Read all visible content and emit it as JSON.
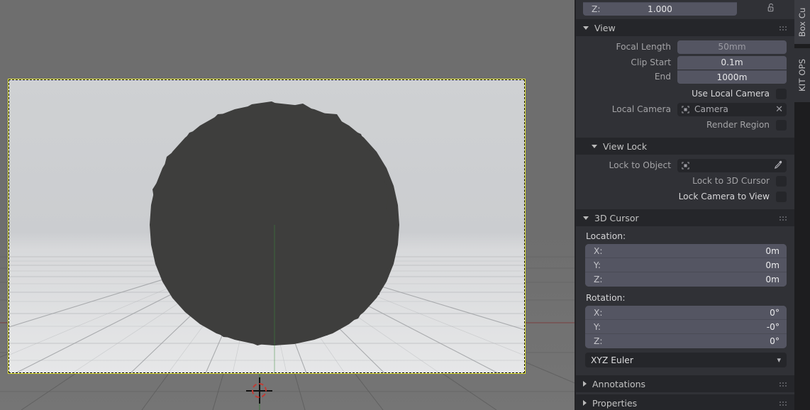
{
  "app": "blender-3d-viewport",
  "viewport": {
    "name": "3d-viewport",
    "camera_frame_visible": true,
    "cursor_icon": "3d-cursor-icon",
    "object": "low-poly-sphere"
  },
  "sidebar": {
    "top_field": {
      "label": "Z:",
      "value": "1.000",
      "lock_icon": "unlocked-padlock-icon"
    },
    "panels": [
      {
        "name": "view",
        "title": "View",
        "expanded": true,
        "grip_icon": "drag-handle-icon",
        "rows": [
          {
            "label": "Focal Length",
            "value": "50mm",
            "dim": true
          },
          {
            "label": "Clip Start",
            "value": "0.1m",
            "dim": false
          },
          {
            "label": "End",
            "value": "1000m",
            "dim": false
          }
        ],
        "checkboxes": [
          {
            "label": "Use Local Camera",
            "checked": false,
            "dim": false
          },
          {
            "label": "Render Region",
            "checked": false,
            "dim": true
          }
        ],
        "local_camera": {
          "label": "Local Camera",
          "value": "Camera",
          "object_icon": "camera-object-icon",
          "clear_icon": "close-x-icon"
        }
      },
      {
        "name": "view-lock",
        "title": "View Lock",
        "expanded": true,
        "lock_to_object": {
          "label": "Lock to Object",
          "value": "",
          "object_icon": "object-data-icon",
          "eyedropper_icon": "eyedropper-icon"
        },
        "checkboxes": [
          {
            "label": "Lock to 3D Cursor",
            "checked": false,
            "dim": true
          },
          {
            "label": "Lock Camera to View",
            "checked": false,
            "dim": false
          }
        ]
      },
      {
        "name": "3d-cursor",
        "title": "3D Cursor",
        "expanded": true,
        "grip_icon": "drag-handle-icon",
        "location": {
          "heading": "Location:",
          "axes": [
            {
              "axis": "X:",
              "value": "0m"
            },
            {
              "axis": "Y:",
              "value": "0m"
            },
            {
              "axis": "Z:",
              "value": "0m"
            }
          ]
        },
        "rotation": {
          "heading": "Rotation:",
          "axes": [
            {
              "axis": "X:",
              "value": "0°"
            },
            {
              "axis": "Y:",
              "value": "-0°"
            },
            {
              "axis": "Z:",
              "value": "0°"
            }
          ]
        },
        "rotation_mode": {
          "value": "XYZ Euler",
          "chevron_icon": "chevron-down-icon"
        }
      },
      {
        "name": "annotations",
        "title": "Annotations",
        "expanded": false,
        "grip_icon": "drag-handle-icon"
      },
      {
        "name": "properties",
        "title": "Properties",
        "expanded": false,
        "grip_icon": "drag-handle-icon"
      }
    ]
  },
  "tabs": [
    {
      "name": "box-cutter",
      "label": "Box Cu",
      "active": true
    },
    {
      "name": "kit-ops",
      "label": "KIT OPS",
      "active": false
    }
  ],
  "colors": {
    "panel_bg": "#303136",
    "header_bg": "#25262a",
    "field_bg": "#545562",
    "text": "#d7d7d9",
    "text_dim": "#a3a3a6",
    "camera_frame": "#e9ea3a",
    "cursor_red": "#c33b33",
    "viewport_bg": "#6e6e6e"
  }
}
